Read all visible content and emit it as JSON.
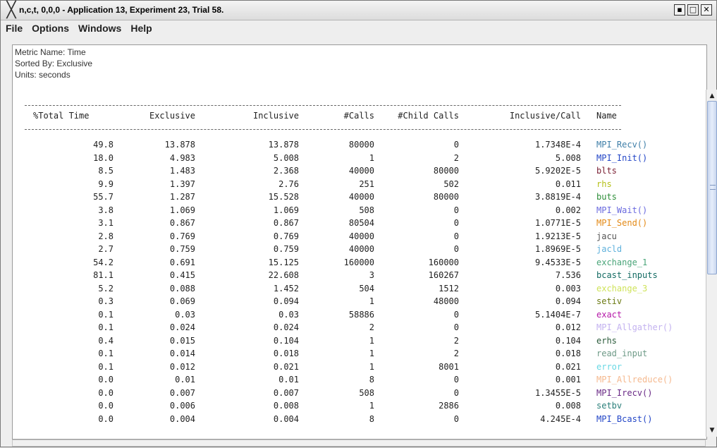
{
  "window": {
    "title": "n,c,t, 0,0,0 - Application 13, Experiment 23, Trial 58.",
    "icon": "x-logo-icon",
    "buttons": [
      "minimize",
      "maximize",
      "close"
    ]
  },
  "menu": [
    "File",
    "Options",
    "Windows",
    "Help"
  ],
  "meta": {
    "metric": "Metric Name: Time",
    "sorted": "Sorted By: Exclusive",
    "units": "Units: seconds"
  },
  "table": {
    "headers": [
      "%Total Time",
      "Exclusive",
      "Inclusive",
      "#Calls",
      "#Child Calls",
      "Inclusive/Call",
      "Name"
    ],
    "rows": [
      {
        "total": "49.8",
        "excl": "13.878",
        "incl": "13.878",
        "calls": "80000",
        "child": "0",
        "per": "1.7348E-4",
        "name": "MPI_Recv()",
        "color": "#3f7fa8"
      },
      {
        "total": "18.0",
        "excl": "4.983",
        "incl": "5.008",
        "calls": "1",
        "child": "2",
        "per": "5.008",
        "name": "MPI_Init()",
        "color": "#2346c7"
      },
      {
        "total": "8.5",
        "excl": "1.483",
        "incl": "2.368",
        "calls": "40000",
        "child": "80000",
        "per": "5.9202E-5",
        "name": "blts",
        "color": "#7a1f33"
      },
      {
        "total": "9.9",
        "excl": "1.397",
        "incl": "2.76",
        "calls": "251",
        "child": "502",
        "per": "0.011",
        "name": "rhs",
        "color": "#b5c018"
      },
      {
        "total": "55.7",
        "excl": "1.287",
        "incl": "15.528",
        "calls": "40000",
        "child": "80000",
        "per": "3.8819E-4",
        "name": "buts",
        "color": "#2f8f3a"
      },
      {
        "total": "3.8",
        "excl": "1.069",
        "incl": "1.069",
        "calls": "508",
        "child": "0",
        "per": "0.002",
        "name": "MPI_Wait()",
        "color": "#6a6adf"
      },
      {
        "total": "3.1",
        "excl": "0.867",
        "incl": "0.867",
        "calls": "80504",
        "child": "0",
        "per": "1.0771E-5",
        "name": "MPI_Send()",
        "color": "#e38a17"
      },
      {
        "total": "2.8",
        "excl": "0.769",
        "incl": "0.769",
        "calls": "40000",
        "child": "0",
        "per": "1.9213E-5",
        "name": "jacu",
        "color": "#555555"
      },
      {
        "total": "2.7",
        "excl": "0.759",
        "incl": "0.759",
        "calls": "40000",
        "child": "0",
        "per": "1.8969E-5",
        "name": "jacld",
        "color": "#5fb1dc"
      },
      {
        "total": "54.2",
        "excl": "0.691",
        "incl": "15.125",
        "calls": "160000",
        "child": "160000",
        "per": "9.4533E-5",
        "name": "exchange_1",
        "color": "#4aa579"
      },
      {
        "total": "81.1",
        "excl": "0.415",
        "incl": "22.608",
        "calls": "3",
        "child": "160267",
        "per": "7.536",
        "name": "bcast_inputs",
        "color": "#136b63"
      },
      {
        "total": "5.2",
        "excl": "0.088",
        "incl": "1.452",
        "calls": "504",
        "child": "1512",
        "per": "0.003",
        "name": "exchange_3",
        "color": "#cfe35a"
      },
      {
        "total": "0.3",
        "excl": "0.069",
        "incl": "0.094",
        "calls": "1",
        "child": "48000",
        "per": "0.094",
        "name": "setiv",
        "color": "#6b7a12"
      },
      {
        "total": "0.1",
        "excl": "0.03",
        "incl": "0.03",
        "calls": "58886",
        "child": "0",
        "per": "5.1404E-7",
        "name": "exact",
        "color": "#b518a8"
      },
      {
        "total": "0.1",
        "excl": "0.024",
        "incl": "0.024",
        "calls": "2",
        "child": "0",
        "per": "0.012",
        "name": "MPI_Allgather()",
        "color": "#c3b2f0"
      },
      {
        "total": "0.4",
        "excl": "0.015",
        "incl": "0.104",
        "calls": "1",
        "child": "2",
        "per": "0.104",
        "name": "erhs",
        "color": "#2a5a3a"
      },
      {
        "total": "0.1",
        "excl": "0.014",
        "incl": "0.018",
        "calls": "1",
        "child": "2",
        "per": "0.018",
        "name": "read_input",
        "color": "#6e9a87"
      },
      {
        "total": "0.1",
        "excl": "0.012",
        "incl": "0.021",
        "calls": "1",
        "child": "8001",
        "per": "0.021",
        "name": "error",
        "color": "#68d8e4"
      },
      {
        "total": "0.0",
        "excl": "0.01",
        "incl": "0.01",
        "calls": "8",
        "child": "0",
        "per": "0.001",
        "name": "MPI_Allreduce()",
        "color": "#f5b98f"
      },
      {
        "total": "0.0",
        "excl": "0.007",
        "incl": "0.007",
        "calls": "508",
        "child": "0",
        "per": "1.3455E-5",
        "name": "MPI_Irecv()",
        "color": "#6a2a86"
      },
      {
        "total": "0.0",
        "excl": "0.006",
        "incl": "0.008",
        "calls": "1",
        "child": "2886",
        "per": "0.008",
        "name": "setbv",
        "color": "#2a7f7a"
      },
      {
        "total": "0.0",
        "excl": "0.004",
        "incl": "0.004",
        "calls": "8",
        "child": "0",
        "per": "4.245E-4",
        "name": "MPI_Bcast()",
        "color": "#2346c7"
      }
    ]
  }
}
